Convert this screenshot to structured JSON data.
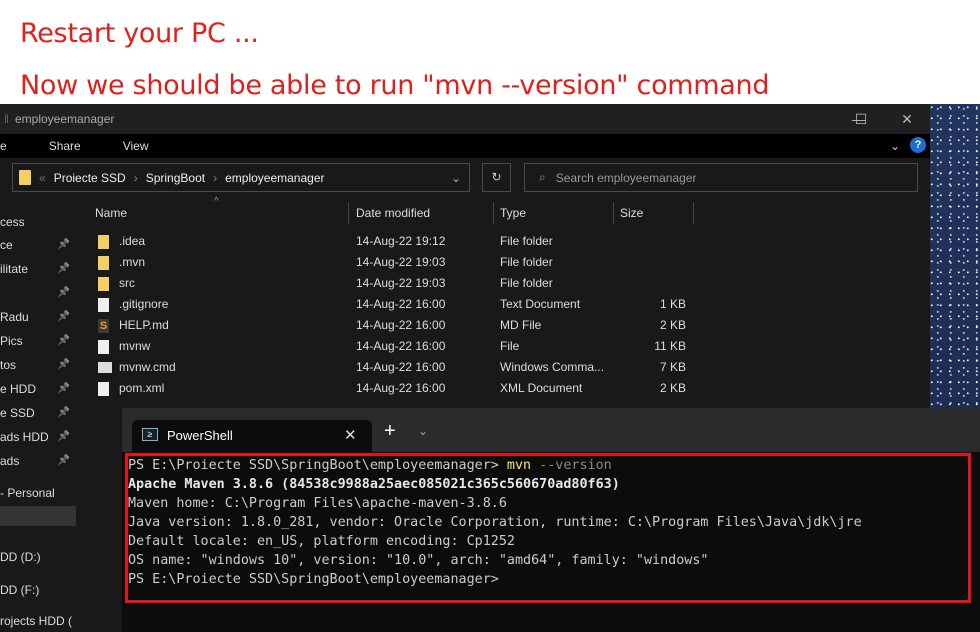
{
  "notes": [
    "Restart your PC ...",
    "Now we should be able to run \"mvn --version\" command"
  ],
  "explorer": {
    "title": "employeemanager",
    "ribbon": [
      "e",
      "Share",
      "View"
    ],
    "breadcrumb": [
      "Proiecte SSD",
      "SpringBoot",
      "employeemanager"
    ],
    "search_placeholder": "Search employeemanager",
    "columns": [
      "Name",
      "Date modified",
      "Type",
      "Size"
    ],
    "sidebar": [
      {
        "label": "cess",
        "pinned": false
      },
      {
        "label": "ce",
        "pinned": true
      },
      {
        "label": "ilitate",
        "pinned": true
      },
      {
        "label": "",
        "pinned": true
      },
      {
        "label": " Radu",
        "pinned": true
      },
      {
        "label": " Pics",
        "pinned": true
      },
      {
        "label": "tos",
        "pinned": true
      },
      {
        "label": "e HDD",
        "pinned": true
      },
      {
        "label": "e SSD",
        "pinned": true
      },
      {
        "label": "ads HDD",
        "pinned": true
      },
      {
        "label": "ads",
        "pinned": true
      },
      {
        "label": " - Personal",
        "pinned": false
      },
      {
        "label": "",
        "pinned": false
      },
      {
        "label": "DD (D:)",
        "pinned": false
      },
      {
        "label": "DD (F:)",
        "pinned": false
      },
      {
        "label": "rojects HDD (",
        "pinned": false
      }
    ],
    "files": [
      {
        "name": ".idea",
        "date": "14-Aug-22 19:12",
        "type": "File folder",
        "size": "",
        "icon": "folder-icon"
      },
      {
        "name": ".mvn",
        "date": "14-Aug-22 19:03",
        "type": "File folder",
        "size": "",
        "icon": "folder-icon"
      },
      {
        "name": "src",
        "date": "14-Aug-22 19:03",
        "type": "File folder",
        "size": "",
        "icon": "folder-icon"
      },
      {
        "name": ".gitignore",
        "date": "14-Aug-22 16:00",
        "type": "Text Document",
        "size": "1 KB",
        "icon": "text-file-icon"
      },
      {
        "name": "HELP.md",
        "date": "14-Aug-22 16:00",
        "type": "MD File",
        "size": "2 KB",
        "icon": "sublime-file-icon"
      },
      {
        "name": "mvnw",
        "date": "14-Aug-22 16:00",
        "type": "File",
        "size": "11 KB",
        "icon": "file-icon"
      },
      {
        "name": "mvnw.cmd",
        "date": "14-Aug-22 16:00",
        "type": "Windows Comma...",
        "size": "7 KB",
        "icon": "cmd-file-icon"
      },
      {
        "name": "pom.xml",
        "date": "14-Aug-22 16:00",
        "type": "XML Document",
        "size": "2 KB",
        "icon": "file-icon"
      }
    ]
  },
  "terminal": {
    "tab": "PowerShell",
    "prompt": "PS E:\\Proiecte SSD\\SpringBoot\\employeemanager> ",
    "command": "mvn",
    "args": " --version",
    "output": [
      "Apache Maven 3.8.6 (84538c9988a25aec085021c365c560670ad80f63)",
      "Maven home: C:\\Program Files\\apache-maven-3.8.6",
      "Java version: 1.8.0_281, vendor: Oracle Corporation, runtime: C:\\Program Files\\Java\\jdk\\jre",
      "Default locale: en_US, platform encoding: Cp1252",
      "OS name: \"windows 10\", version: \"10.0\", arch: \"amd64\", family: \"windows\""
    ],
    "final_prompt": "PS E:\\Proiecte SSD\\SpringBoot\\employeemanager>"
  },
  "colors": {
    "annotation": "#e0201c",
    "highlight_border": "#e3141b"
  }
}
